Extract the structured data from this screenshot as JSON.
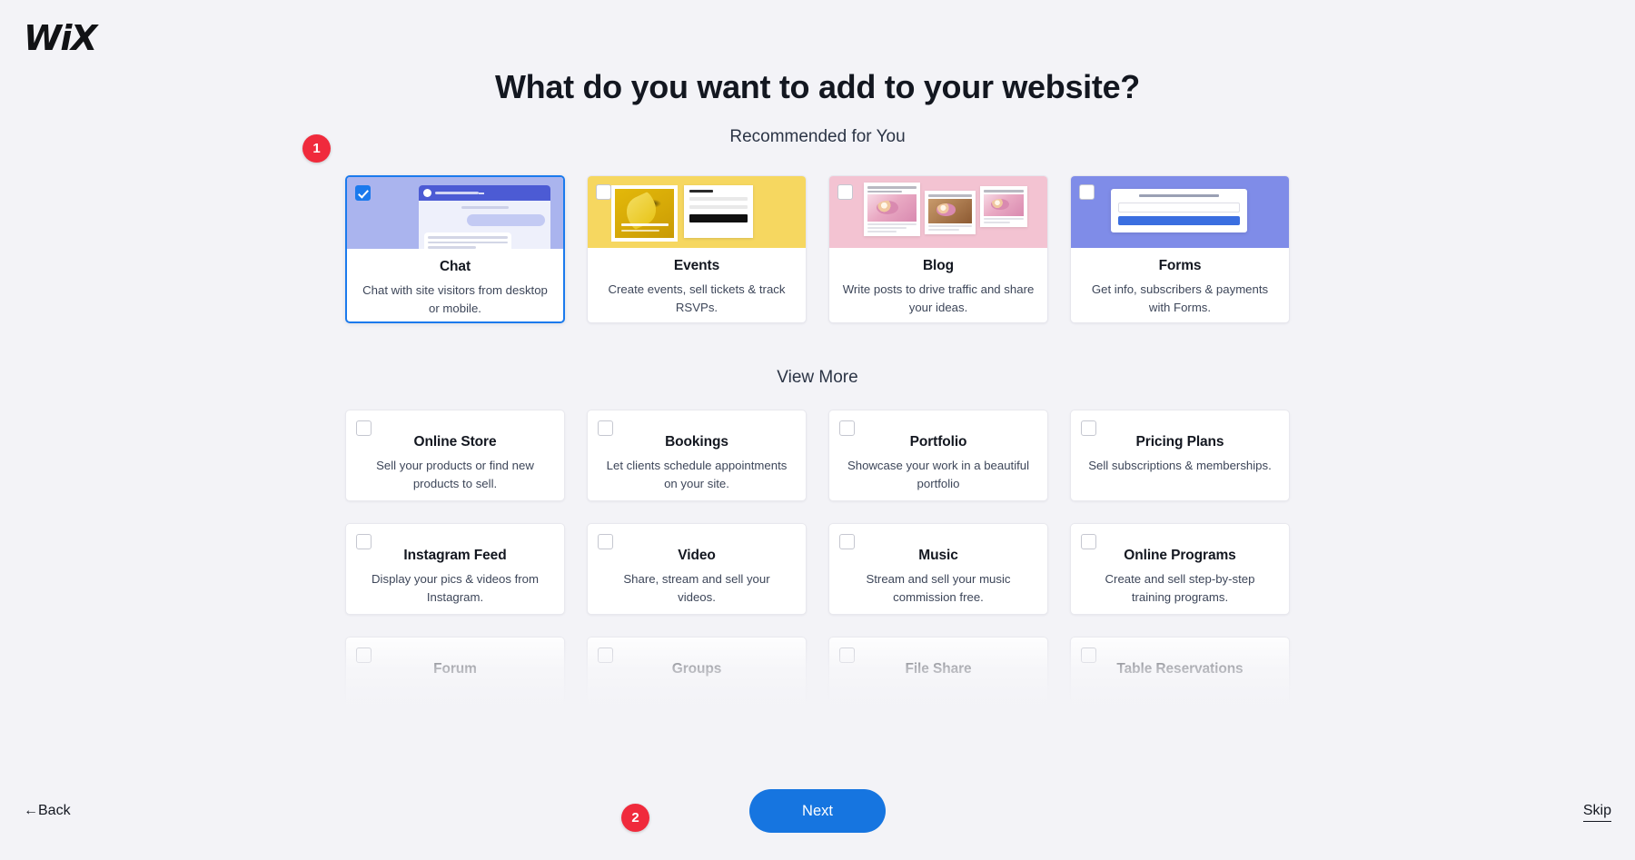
{
  "brand": {
    "logo_text": "WiX"
  },
  "header": {
    "title": "What do you want to add to your website?"
  },
  "sections": {
    "recommended_label": "Recommended for You",
    "view_more_label": "View More"
  },
  "recommended": [
    {
      "name": "Chat",
      "description": "Chat with site visitors from desktop or mobile.",
      "selected": true,
      "thumb_color": "#aab4ee"
    },
    {
      "name": "Events",
      "description": "Create events, sell tickets & track RSVPs.",
      "selected": false,
      "thumb_color": "#f6d760"
    },
    {
      "name": "Blog",
      "description": "Write posts to drive traffic and share your ideas.",
      "selected": false,
      "thumb_color": "#f3c3d2"
    },
    {
      "name": "Forms",
      "description": "Get info, subscribers & payments with Forms.",
      "selected": false,
      "thumb_color": "#7f8ce8"
    }
  ],
  "view_more": [
    {
      "name": "Online Store",
      "description": "Sell your products or find new products to sell."
    },
    {
      "name": "Bookings",
      "description": "Let clients schedule appointments on your site."
    },
    {
      "name": "Portfolio",
      "description": "Showcase your work in a beautiful portfolio"
    },
    {
      "name": "Pricing Plans",
      "description": "Sell subscriptions & memberships."
    },
    {
      "name": "Instagram Feed",
      "description": "Display your pics & videos from Instagram."
    },
    {
      "name": "Video",
      "description": "Share, stream and sell your videos."
    },
    {
      "name": "Music",
      "description": "Stream and sell your music commission free."
    },
    {
      "name": "Online Programs",
      "description": "Create and sell step-by-step training programs."
    },
    {
      "name": "Forum",
      "description": ""
    },
    {
      "name": "Groups",
      "description": ""
    },
    {
      "name": "File Share",
      "description": ""
    },
    {
      "name": "Table Reservations",
      "description": ""
    }
  ],
  "footer": {
    "back_label": "←Back",
    "next_label": "Next",
    "skip_label": "Skip"
  },
  "annotations": [
    {
      "id": "1",
      "label": "1"
    },
    {
      "id": "2",
      "label": "2"
    }
  ],
  "colors": {
    "accent": "#1675e0",
    "badge": "#f02a3c",
    "background": "#f3f3f7",
    "selected_border": "#1b7aed"
  }
}
